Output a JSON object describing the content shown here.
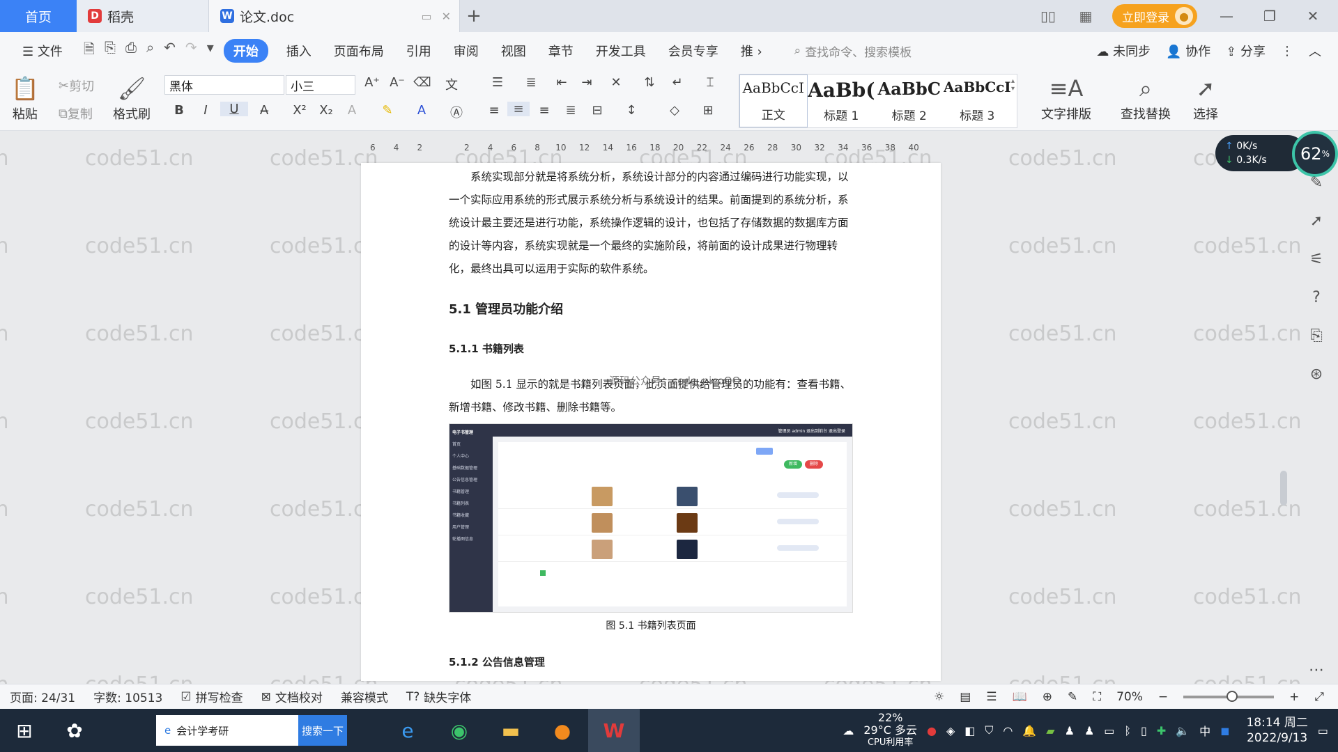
{
  "titlebar": {
    "home_tab": "首页",
    "tabs": [
      {
        "label": "稻壳",
        "icon": "daoke-logo-icon"
      },
      {
        "label": "论文.doc",
        "icon": "wps-writer-icon"
      }
    ],
    "login_label": "立即登录"
  },
  "menubar": {
    "file_label": "文件",
    "items": [
      "开始",
      "插入",
      "页面布局",
      "引用",
      "审阅",
      "视图",
      "章节",
      "开发工具",
      "会员专享",
      "推"
    ],
    "active_item": "开始",
    "search_cmd": "查找命令、搜索模板",
    "right": {
      "sync": "未同步",
      "collab": "协作",
      "share": "分享"
    }
  },
  "ribbon": {
    "paste": "粘贴",
    "cut": "剪切",
    "copy": "复制",
    "format_painter": "格式刷",
    "font_name": "黑体",
    "font_size": "小三",
    "styles": [
      {
        "sample": "AaBbCcI",
        "name": "正文"
      },
      {
        "sample": "AaBb(",
        "name": "标题 1"
      },
      {
        "sample": "AaBbC",
        "name": "标题 2"
      },
      {
        "sample": "AaBbCcI",
        "name": "标题 3"
      }
    ],
    "text_layout": "文字排版",
    "find_replace": "查找替换",
    "select": "选择"
  },
  "ruler": {
    "ticks": [
      "6",
      "4",
      "2",
      "",
      "2",
      "4",
      "6",
      "8",
      "10",
      "12",
      "14",
      "16",
      "18",
      "20",
      "22",
      "24",
      "26",
      "28",
      "30",
      "32",
      "34",
      "36",
      "38",
      "40"
    ]
  },
  "document": {
    "paragraph1": "系统实现部分就是将系统分析，系统设计部分的内容通过编码进行功能实现，以一个实际应用系统的形式展示系统分析与系统设计的结果。前面提到的系统分析，系统设计最主要还是进行功能，系统操作逻辑的设计，也包括了存储数据的数据库方面的设计等内容，系统实现就是一个最终的实施阶段，将前面的设计成果进行物理转化，最终出具可以运用于实际的软件系统。",
    "heading_5_1": "5.1  管理员功能介绍",
    "heading_5_1_1": "5.1.1  书籍列表",
    "paragraph2": "如图 5.1 显示的就是书籍列表页面，此页面提供给管理员的功能有：查看书籍、新增书籍、修改书籍、删除书籍等。",
    "overlay_text": "源码公众号：code_nicoQQ",
    "figure_caption": "图 5.1  书籍列表页面",
    "heading_5_1_2": "5.1.2  公告信息管理",
    "figure": {
      "app_title": "电子书管理",
      "top_links": "管理员 admin   退出到前台   退出登录",
      "sidebar_items": [
        "首页",
        "个人中心",
        "基础数据管理",
        "公告信息管理",
        "书籍管理",
        "书籍列表",
        "书籍收藏",
        "用户管理",
        "轮播图信息"
      ],
      "add_button": "新增",
      "delete_button": "删除"
    }
  },
  "net_widget": {
    "up": "0K/s",
    "down": "0.3K/s",
    "percent": "62",
    "percent_unit": "%"
  },
  "statusbar": {
    "page": "页面: 24/31",
    "words": "字数: 10513",
    "spellcheck": "拼写检查",
    "doc_proof": "文档校对",
    "compat": "兼容模式",
    "missing_font": "缺失字体",
    "zoom": "70%"
  },
  "taskbar": {
    "search_text": "会计学考研",
    "search_button": "搜索一下",
    "weather_temp": "29°C 多云",
    "cpu_label": "22%",
    "cpu_caption": "CPU利用率",
    "ime": "中",
    "time": "18:14 周二",
    "date": "2022/9/13"
  },
  "watermark": "code51.cn"
}
